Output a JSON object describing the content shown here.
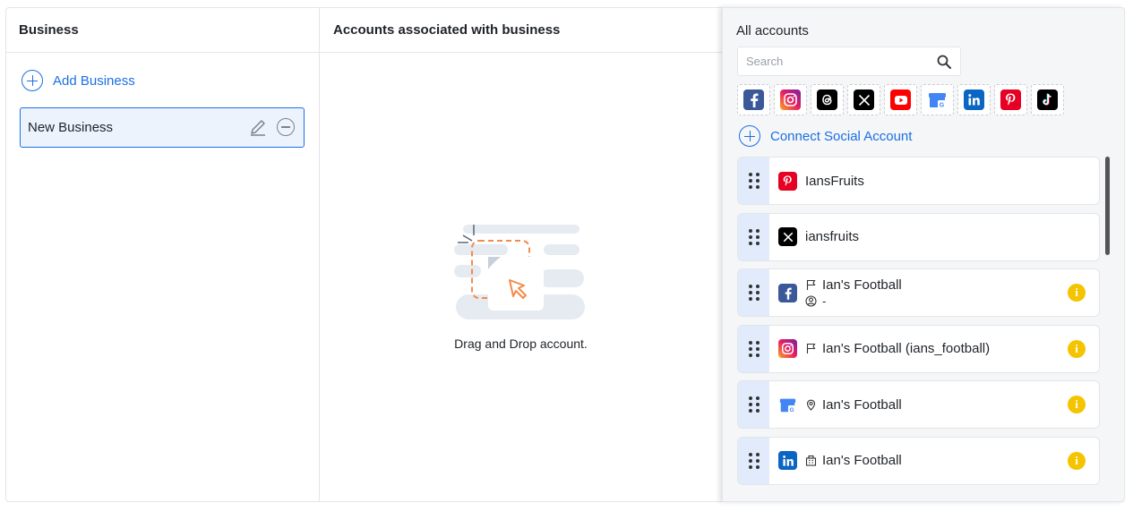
{
  "columns": {
    "business_header": "Business",
    "associated_header": "Accounts associated with business"
  },
  "business": {
    "add_label": "Add Business",
    "items": [
      {
        "name": "New Business"
      }
    ]
  },
  "drop_zone": {
    "text": "Drag and Drop account."
  },
  "panel": {
    "title": "All accounts",
    "search_placeholder": "Search",
    "networks": [
      "facebook",
      "instagram",
      "threads",
      "x",
      "youtube",
      "google-business",
      "linkedin",
      "pinterest",
      "tiktok"
    ],
    "connect_label": "Connect Social Account",
    "accounts": [
      {
        "network": "pinterest",
        "name": "IansFruits"
      },
      {
        "network": "x",
        "name": "iansfruits"
      },
      {
        "network": "facebook",
        "name": "Ian's Football",
        "sub": "-",
        "type": "page",
        "warning": true
      },
      {
        "network": "instagram",
        "name": "Ian's Football (ians_football)",
        "type": "page",
        "warning": true
      },
      {
        "network": "google-business",
        "name": "Ian's Football",
        "type": "location",
        "warning": true
      },
      {
        "network": "linkedin",
        "name": "Ian's Football",
        "type": "company",
        "warning": true
      }
    ]
  },
  "colors": {
    "accent": "#1b6fe4",
    "selected_bg": "#edf3fd",
    "handle_bg": "#e1ebfb",
    "warning": "#f5c400"
  }
}
